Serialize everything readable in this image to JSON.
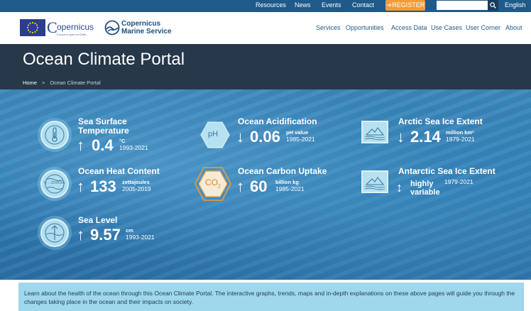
{
  "topbar": {
    "links": [
      "Resources",
      "News",
      "Events",
      "Contact"
    ],
    "register_label": "REGISTER",
    "search_placeholder": "",
    "language": "English"
  },
  "header": {
    "copernicus_word": "opernicus",
    "copernicus_letter": "C",
    "copernicus_tagline": "Europe's eyes on Earth",
    "cms_line1": "Copernicus",
    "cms_line2": "Marine Service",
    "nav": [
      "Services",
      "Opportunities",
      "Access Data",
      "Use Cases",
      "User Corner",
      "About"
    ]
  },
  "title_band": {
    "title": "Ocean Climate Portal",
    "breadcrumb_home": "Home",
    "breadcrumb_sep": ">",
    "breadcrumb_current": "Ocean Climate Portal"
  },
  "indicators": {
    "sst": {
      "title1": "Sea Surface",
      "title2": "Temperature",
      "arrow": "↑",
      "value": "0.4",
      "unit": "°C",
      "period": "1993-2021",
      "icon": "thermometer-icon"
    },
    "ohc": {
      "title": "Ocean Heat Content",
      "arrow": "↑",
      "value": "133",
      "unit": "zettajoules",
      "period": "2005-2019",
      "icon_label": "0 - 2000m",
      "icon": "depth-icon"
    },
    "sl": {
      "title": "Sea Level",
      "arrow": "↑",
      "value": "9.57",
      "unit": "cm",
      "period": "1993-2021",
      "icon": "sea-level-icon"
    },
    "oa": {
      "title": "Ocean Acidification",
      "arrow": "↓",
      "value": "0.06",
      "unit": "pH value",
      "period": "1985-2021",
      "icon_label": "pH",
      "icon": "ph-icon"
    },
    "ocu": {
      "title": "Ocean Carbon Uptake",
      "arrow": "↑",
      "value": "60",
      "unit": "billion kg",
      "period": "1985-2021",
      "icon_label": "CO",
      "icon_sub": "2",
      "icon": "co2-icon"
    },
    "arctic": {
      "title": "Arctic Sea Ice Extent",
      "arrow": "↓",
      "value": "2.14",
      "unit": "million km²",
      "period": "1979-2021",
      "icon": "arctic-ice-icon"
    },
    "antarctic": {
      "title": "Antarctic Sea Ice Extent",
      "arrow": "↕",
      "text1": "highly",
      "text2": "variable",
      "period": "1979-2021",
      "icon": "antarctic-ice-icon"
    }
  },
  "info": {
    "text": "Learn about the health of the ocean through this Ocean Climate Portal. The interactive graphs, trends, maps and in-depth explanations on these above pages will guide you through the changes taking place in the ocean and their impacts on society."
  },
  "colors": {
    "topbar": "#1e5a8a",
    "register": "#f29c38",
    "title_band": "#27384a",
    "accent_orange": "#f29c38",
    "info_box": "#9fd7ec"
  }
}
